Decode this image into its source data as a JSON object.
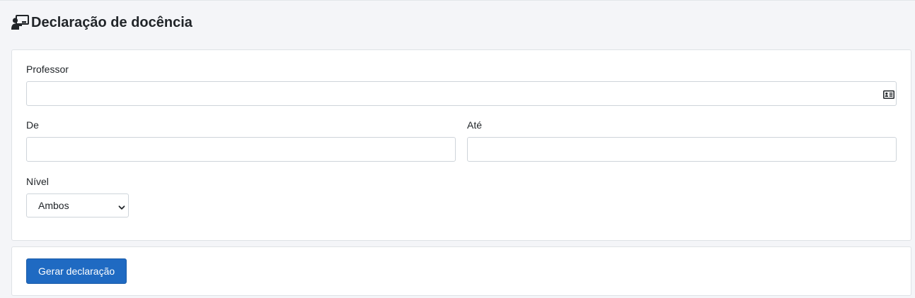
{
  "header": {
    "title": "Declaração de docência",
    "icon": "teacher-board-icon"
  },
  "form": {
    "professor": {
      "label": "Professor",
      "value": "",
      "placeholder": "",
      "icon": "id-card-icon"
    },
    "de": {
      "label": "De",
      "value": "",
      "placeholder": ""
    },
    "ate": {
      "label": "Até",
      "value": "",
      "placeholder": ""
    },
    "nivel": {
      "label": "Nível",
      "selected": "Ambos",
      "icon": "chevron-down-icon"
    }
  },
  "actions": {
    "generate_label": "Gerar declaração"
  },
  "colors": {
    "background": "#f4f5f8",
    "primary": "#1f6ac2",
    "border": "#ced4da"
  }
}
